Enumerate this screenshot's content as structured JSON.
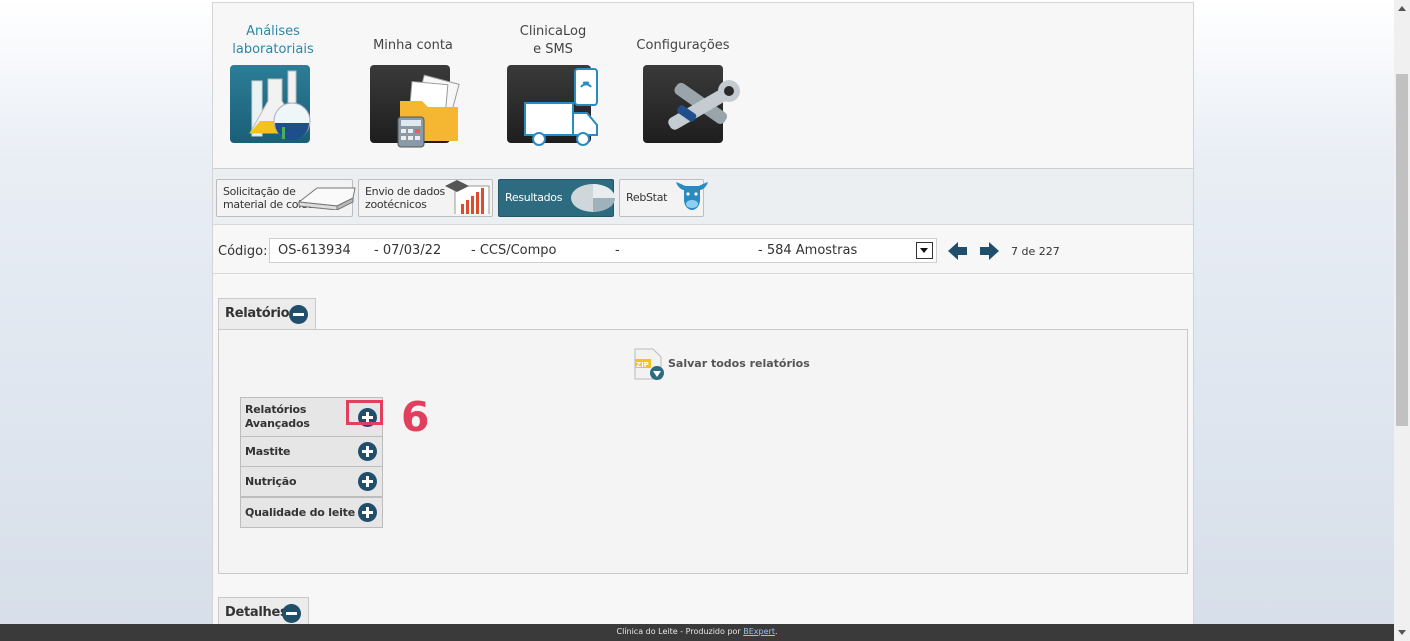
{
  "main_nav": [
    {
      "label_line1": "Análises",
      "label_line2": "laboratoriais",
      "icon": "lab-flask-icon",
      "active": true
    },
    {
      "label_line1": "Minha conta",
      "label_line2": "",
      "icon": "account-folder-icon",
      "active": false
    },
    {
      "label_line1": "ClinicaLog",
      "label_line2": "e SMS",
      "icon": "truck-phone-icon",
      "active": false
    },
    {
      "label_line1": "Configurações",
      "label_line2": "",
      "icon": "wrench-tools-icon",
      "active": false
    }
  ],
  "sub_nav": [
    {
      "label_line1": "Solicitação de",
      "label_line2": "material de coleta",
      "icon": "scanner-icon"
    },
    {
      "label_line1": "Envio de dados",
      "label_line2": "zootécnicos",
      "icon": "graduation-chart-icon"
    },
    {
      "label_line1": "Resultados",
      "label_line2": "",
      "icon": "pie-chart-icon",
      "active": true
    },
    {
      "label_line1": "RebStat",
      "label_line2": "",
      "icon": "cow-icon"
    }
  ],
  "code_bar": {
    "label": "Código:",
    "code": "OS-613934",
    "date": "- 07/03/22",
    "type": "- CCS/Compo",
    "dash": "-",
    "samples": "- 584 Amostras",
    "page_count": "7 de 227"
  },
  "reports_panel": {
    "title": "Relatórios",
    "save_all": "Salvar todos relatórios",
    "zip_badge": "ZIP",
    "items": [
      {
        "label_line1": "Relatórios",
        "label_line2": "Avançados"
      },
      {
        "label_line1": "Mastite",
        "label_line2": ""
      },
      {
        "label_line1": "Nutrição",
        "label_line2": ""
      },
      {
        "label_line1": "Qualidade do leite",
        "label_line2": ""
      }
    ]
  },
  "annotation": {
    "step": "6"
  },
  "details_panel": {
    "title": "Detalhes"
  },
  "footer": {
    "text": "Clínica do Leite - Produzido por ",
    "link": "BExpert",
    "suffix": "."
  },
  "colors": {
    "accent": "#2b86a7",
    "highlight": "#e0405e",
    "dark_blue": "#1f4f6a"
  }
}
